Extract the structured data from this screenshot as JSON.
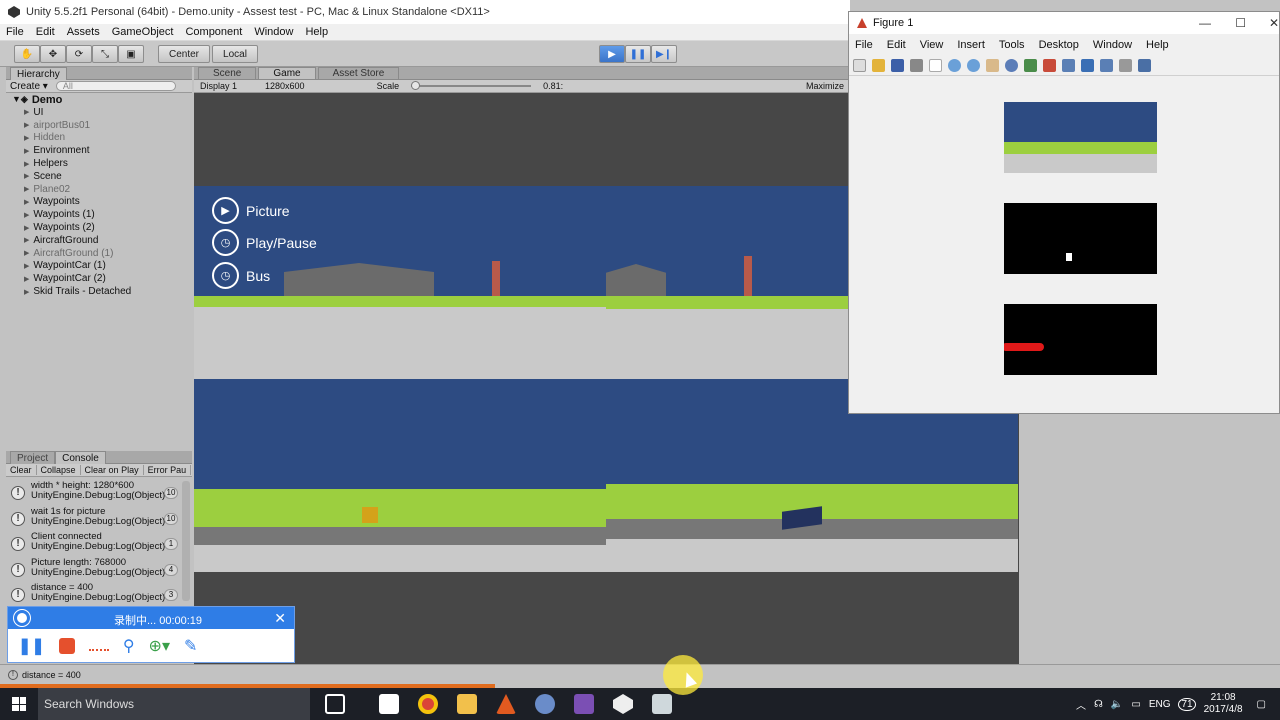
{
  "unity": {
    "title": "Unity 5.5.2f1 Personal (64bit) - Demo.unity - Assest test - PC, Mac & Linux Standalone <DX11>",
    "menu": [
      "File",
      "Edit",
      "Assets",
      "GameObject",
      "Component",
      "Window",
      "Help"
    ],
    "toolbar": {
      "center_label": "Center",
      "local_label": "Local"
    }
  },
  "hierarchy": {
    "tab_label": "Hierarchy",
    "create_label": "Create",
    "search_placeholder": "All",
    "scene_name": "Demo",
    "items": [
      {
        "label": "UI",
        "dim": false
      },
      {
        "label": "airportBus01",
        "dim": true
      },
      {
        "label": "Hidden",
        "dim": true
      },
      {
        "label": "Environment",
        "dim": false
      },
      {
        "label": "Helpers",
        "dim": false
      },
      {
        "label": "Scene",
        "dim": false
      },
      {
        "label": "Plane02",
        "dim": true
      },
      {
        "label": "Waypoints",
        "dim": false
      },
      {
        "label": "Waypoints (1)",
        "dim": false
      },
      {
        "label": "Waypoints (2)",
        "dim": false
      },
      {
        "label": "AircraftGround",
        "dim": false
      },
      {
        "label": "AircraftGround (1)",
        "dim": true
      },
      {
        "label": "WaypointCar (1)",
        "dim": false
      },
      {
        "label": "WaypointCar (2)",
        "dim": false
      },
      {
        "label": "Skid Trails - Detached",
        "dim": false
      }
    ]
  },
  "views": {
    "tabs": [
      "Scene",
      "Game",
      "Asset Store"
    ],
    "display": "Display 1",
    "resolution": "1280x600",
    "scale_label": "Scale",
    "scale_value": "0.81:",
    "maximize": "Maximize"
  },
  "game_menu": [
    "Picture",
    "Play/Pause",
    "Bus"
  ],
  "console": {
    "tabs": [
      "Project",
      "Console"
    ],
    "buttons": [
      "Clear",
      "Collapse",
      "Clear on Play",
      "Error Pau"
    ],
    "logs": [
      {
        "line1": "width * height: 1280*600",
        "line2": "UnityEngine.Debug:Log(Object)",
        "count": "10"
      },
      {
        "line1": "wait 1s for picture",
        "line2": "UnityEngine.Debug:Log(Object)",
        "count": "10"
      },
      {
        "line1": "Client connected",
        "line2": "UnityEngine.Debug:Log(Object)",
        "count": "1"
      },
      {
        "line1": "Picture length: 768000",
        "line2": "UnityEngine.Debug:Log(Object)",
        "count": "4"
      },
      {
        "line1": "distance = 400",
        "line2": "UnityEngine.Debug:Log(Object)",
        "count": "3"
      }
    ],
    "status": "distance = 400"
  },
  "recorder": {
    "title": "录制中... 00:00:19"
  },
  "figure": {
    "title": "Figure 1",
    "menu": [
      "File",
      "Edit",
      "View",
      "Insert",
      "Tools",
      "Desktop",
      "Window",
      "Help"
    ]
  },
  "taskbar": {
    "search_placeholder": "Search Windows",
    "lang": "ENG",
    "badge": "71",
    "time": "21:08",
    "date": "2017/4/8"
  },
  "colors": {
    "accent": "#2f7de6",
    "sky": "#2d4b82",
    "grass": "#9ccf3f",
    "taskbar": "#1c1f26"
  }
}
